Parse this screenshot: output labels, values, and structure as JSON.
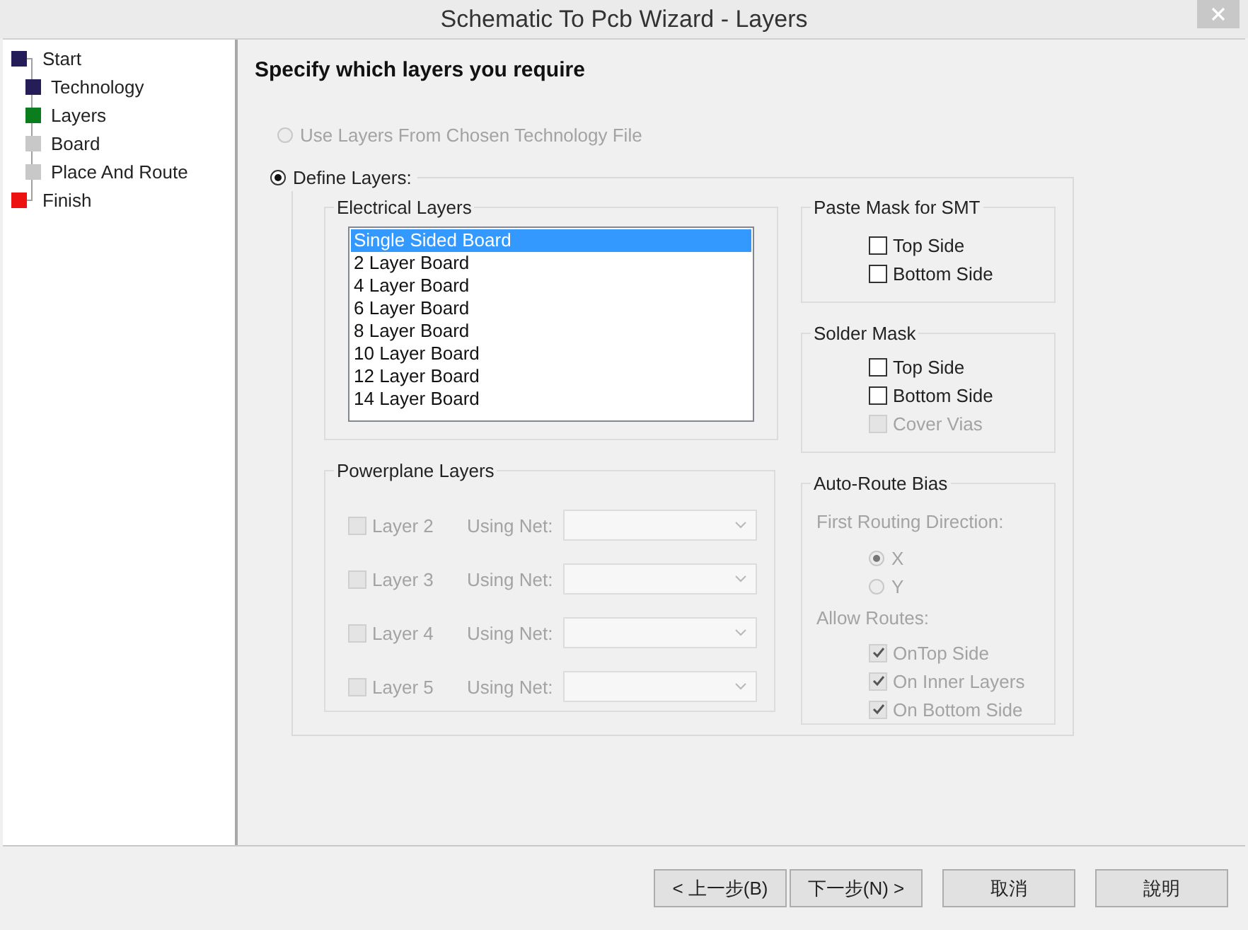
{
  "window": {
    "title": "Schematic To Pcb Wizard - Layers"
  },
  "tree": [
    {
      "label": "Start",
      "color": "#241d57",
      "children": [
        {
          "label": "Technology",
          "color": "#241d57"
        },
        {
          "label": "Layers",
          "color": "#0b7d1c"
        },
        {
          "label": "Board",
          "color": "#c8c8c8"
        },
        {
          "label": "Place And Route",
          "color": "#c8c8c8"
        }
      ]
    },
    {
      "label": "Finish",
      "color": "#ee1111"
    }
  ],
  "heading": "Specify which layers you require",
  "layer_source": [
    {
      "label": "Use Layers From Chosen Technology File",
      "selected": false,
      "disabled": true
    },
    {
      "label": "Define Layers:",
      "selected": true,
      "disabled": false
    }
  ],
  "electrical_layers": {
    "title": "Electrical Layers",
    "items": [
      {
        "label": "Single Sided Board",
        "selected": true
      },
      {
        "label": "2 Layer Board",
        "selected": false
      },
      {
        "label": "4 Layer Board",
        "selected": false
      },
      {
        "label": "6 Layer Board",
        "selected": false
      },
      {
        "label": "8 Layer Board",
        "selected": false
      },
      {
        "label": "10 Layer Board",
        "selected": false
      },
      {
        "label": "12 Layer Board",
        "selected": false
      },
      {
        "label": "14 Layer Board",
        "selected": false
      }
    ]
  },
  "powerplane_layers": {
    "title": "Powerplane Layers",
    "rows": [
      {
        "label": "Layer 2",
        "checked": false,
        "disabled": true,
        "net_label": "Using Net:"
      },
      {
        "label": "Layer 3",
        "checked": false,
        "disabled": true,
        "net_label": "Using Net:"
      },
      {
        "label": "Layer 4",
        "checked": false,
        "disabled": true,
        "net_label": "Using Net:"
      },
      {
        "label": "Layer 5",
        "checked": false,
        "disabled": true,
        "net_label": "Using Net:"
      }
    ]
  },
  "paste_mask": {
    "title": "Paste Mask for SMT",
    "options": [
      {
        "label": "Top Side",
        "checked": false,
        "disabled": false
      },
      {
        "label": "Bottom Side",
        "checked": false,
        "disabled": false
      }
    ]
  },
  "solder_mask": {
    "title": "Solder Mask",
    "options": [
      {
        "label": "Top Side",
        "checked": false,
        "disabled": false
      },
      {
        "label": "Bottom Side",
        "checked": false,
        "disabled": false
      },
      {
        "label": "Cover Vias",
        "checked": false,
        "disabled": true
      }
    ]
  },
  "auto_route_bias": {
    "title": "Auto-Route Bias",
    "direction_label": "First Routing Direction:",
    "directions": [
      {
        "label": "X",
        "selected": true,
        "disabled": true
      },
      {
        "label": "Y",
        "selected": false,
        "disabled": true
      }
    ],
    "routes_label": "Allow Routes:",
    "routes": [
      {
        "label": "OnTop Side",
        "checked": true,
        "disabled": true
      },
      {
        "label": "On Inner Layers",
        "checked": true,
        "disabled": true
      },
      {
        "label": "On Bottom Side",
        "checked": true,
        "disabled": true
      }
    ]
  },
  "buttons": [
    {
      "label": "< 上一步(B)"
    },
    {
      "label": "下一步(N) >"
    },
    {
      "label": "取消"
    },
    {
      "label": "說明"
    }
  ]
}
